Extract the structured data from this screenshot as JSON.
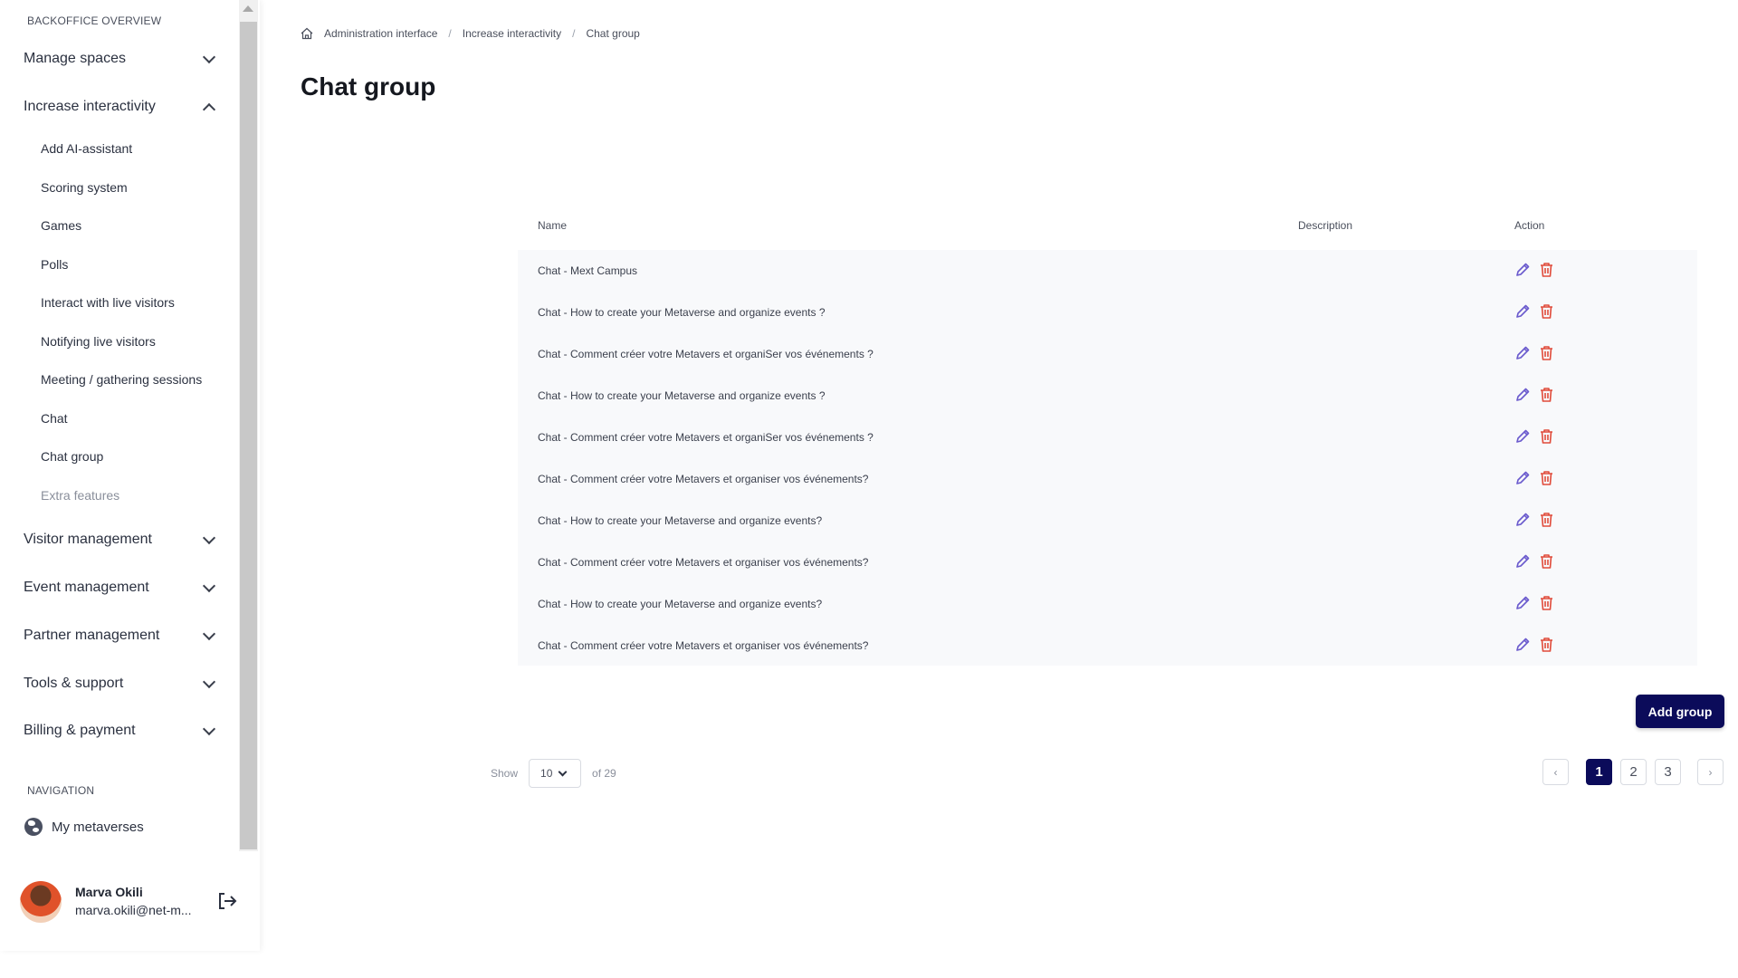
{
  "sidebar": {
    "section_title": "BACKOFFICE OVERVIEW",
    "groups": {
      "manage_spaces": "Manage spaces",
      "increase_interactivity": "Increase interactivity",
      "visitor_management": "Visitor management",
      "event_management": "Event management",
      "partner_management": "Partner management",
      "tools_support": "Tools & support",
      "billing_payment": "Billing & payment"
    },
    "sub_items": [
      "Add AI-assistant",
      "Scoring system",
      "Games",
      "Polls",
      "Interact with live visitors",
      "Notifying live visitors",
      "Meeting / gathering sessions",
      "Chat",
      "Chat group",
      "Extra features"
    ],
    "navigation_title": "NAVIGATION",
    "my_metaverses": "My metaverses",
    "user": {
      "name": "Marva Okili",
      "email": "marva.okili@net-m..."
    }
  },
  "breadcrumb": [
    "Administration interface",
    "Increase interactivity",
    "Chat group"
  ],
  "page_title": "Chat group",
  "table": {
    "headers": {
      "name": "Name",
      "description": "Description",
      "action": "Action"
    },
    "rows": [
      "Chat - Mext Campus",
      "Chat - How to create your Metaverse and organize events ?",
      "Chat - Comment créer votre Metavers et organiSer vos événements ?",
      "Chat - How to create your Metaverse and organize events ?",
      "Chat - Comment créer votre Metavers et organiSer vos événements ?",
      "Chat - Comment créer votre Metavers et organiser vos événements?",
      "Chat - How to create your Metaverse and organize events?",
      "Chat - Comment créer votre Metavers et organiser vos événements?",
      "Chat - How to create your Metaverse and organize events?",
      "Chat - Comment créer votre Metavers et organiser vos événements?"
    ]
  },
  "add_button": "Add group",
  "pagination": {
    "show_label": "Show",
    "page_size": "10",
    "total_label": "of 29",
    "prev": "‹",
    "next": "›",
    "pages": [
      "1",
      "2",
      "3"
    ],
    "current_page": "1"
  },
  "colors": {
    "primary": "#0b0b5a",
    "edit_icon": "#6a5acd",
    "delete_icon": "#e04b3a"
  },
  "icons": {
    "edit": "pencil-icon",
    "delete": "trash-icon",
    "home": "home-icon",
    "navigation": "globe-icon",
    "logout": "logout-icon"
  }
}
